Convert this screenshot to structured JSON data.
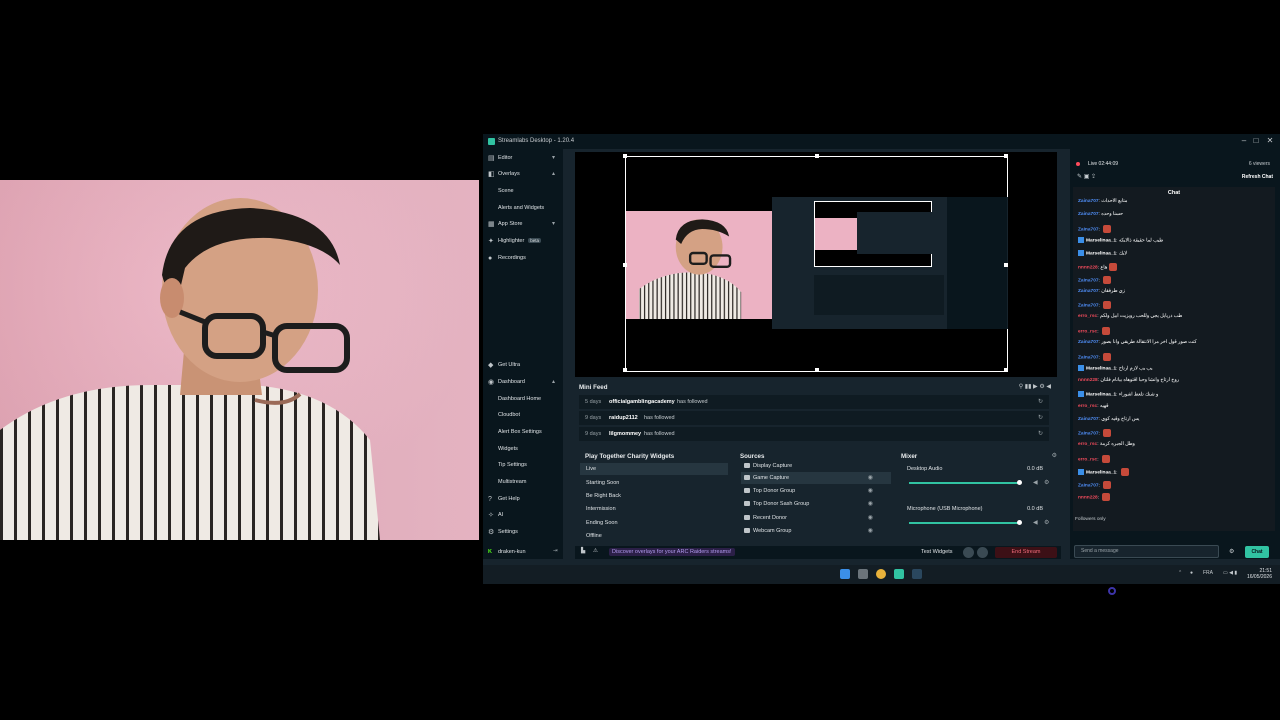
{
  "app": {
    "title": "Streamlabs Desktop - 1.20.4"
  },
  "sidebar": {
    "items": [
      {
        "label": "Editor",
        "icon": "editor-icon",
        "chevron": "▾"
      },
      {
        "label": "Overlays",
        "icon": "overlays-icon",
        "chevron": "▴"
      },
      {
        "label": "Scene",
        "sub": true
      },
      {
        "label": "Alerts and Widgets",
        "sub": true
      },
      {
        "label": "App Store",
        "icon": "app-store-icon",
        "chevron": "▾"
      },
      {
        "label": "Highlighter",
        "icon": "highlighter-icon",
        "badge": "beta"
      },
      {
        "label": "Recordings",
        "icon": "recordings-icon"
      }
    ],
    "bottom_items": [
      {
        "label": "Get Ultra",
        "icon": "ultra-icon"
      },
      {
        "label": "Dashboard",
        "icon": "dashboard-icon",
        "chevron": "▴"
      },
      {
        "label": "Dashboard Home",
        "sub": true
      },
      {
        "label": "Cloudbot",
        "sub": true
      },
      {
        "label": "Alert Box Settings",
        "sub": true
      },
      {
        "label": "Widgets",
        "sub": true
      },
      {
        "label": "Tip Settings",
        "sub": true
      },
      {
        "label": "Multistream",
        "sub": true
      },
      {
        "label": "Get Help",
        "icon": "help-icon"
      },
      {
        "label": "AI",
        "icon": "ai-icon"
      },
      {
        "label": "Settings",
        "icon": "gear-icon"
      }
    ],
    "user": "draken-kun"
  },
  "minifeed": {
    "title": "Mini Feed",
    "rows": [
      {
        "age": "5 days",
        "name": "officialgamblingacademy",
        "action": "has followed"
      },
      {
        "age": "9 days",
        "name": "raidup2112",
        "action": "has followed"
      },
      {
        "age": "9 days",
        "name": "lilgmommey",
        "action": "has followed"
      }
    ]
  },
  "scenes": {
    "title": "Play Together Charity Widgets",
    "items": [
      "Live",
      "Starting Soon",
      "Be Right Back",
      "Intermission",
      "Ending Soon",
      "Offline"
    ]
  },
  "sources": {
    "title": "Sources",
    "items": [
      "Display Capture",
      "Game Capture",
      "Top Donor Group",
      "Top Donor Sash Group",
      "Recent Donor",
      "Webcam Group"
    ]
  },
  "mixer": {
    "title": "Mixer",
    "channels": [
      {
        "name": "Desktop Audio",
        "db": "0.0 dB",
        "level": 0.8
      },
      {
        "name": "Microphone (USB Microphone)",
        "db": "0.0 dB",
        "level": 0.8
      }
    ]
  },
  "footer": {
    "promo": "Discover overlays for your ARC Raiders streams!",
    "test_widgets": "Test Widgets",
    "end_stream": "End Stream"
  },
  "chat": {
    "live": "Live 02:44:09",
    "viewers": "6 viewers",
    "refresh": "Refresh Chat",
    "title": "Chat",
    "messages": [
      {
        "user": "Zaina707",
        "text": "متابع الاحداث",
        "color": "#4f8ef7"
      },
      {
        "user": "Zaina707",
        "text": "حسنا وحده",
        "color": "#4f8ef7"
      },
      {
        "user": "Zaina707",
        "text": "",
        "color": "#4f8ef7",
        "emote": true
      },
      {
        "user": "Marselinaa_1",
        "text": "طيب لما حقيقة ذالايكه",
        "color": "#ffffff",
        "badge": true
      },
      {
        "user": "Marselinaa_1",
        "text": "لايك",
        "color": "#ffffff",
        "badge": true
      },
      {
        "user": "nnnn228",
        "text": "هاع",
        "color": "#f14b5c",
        "emote": true
      },
      {
        "user": "Zaina707",
        "text": "",
        "color": "#4f8ef7",
        "emote": true
      },
      {
        "user": "Zaina707",
        "text": "زي طرفقان",
        "color": "#4f8ef7"
      },
      {
        "user": "Zaina707",
        "text": "",
        "color": "#4f8ef7",
        "emote": true
      },
      {
        "user": "erro_rsc",
        "text": "طب دريايل يجي وللحب رويزيت ابيل ولكم",
        "color": "#f14b5c"
      },
      {
        "user": "erro_rsc",
        "text": "",
        "color": "#f14b5c",
        "emote": true
      },
      {
        "user": "Zaina707",
        "text": "كنت صور قول اخر مرا الانتقالة طريقي وانا بصور",
        "color": "#4f8ef7"
      },
      {
        "user": "Zaina707",
        "text": "",
        "color": "#4f8ef7",
        "emote": true
      },
      {
        "user": "Marselinaa_1",
        "text": "يب يب لازم ارتاح",
        "color": "#ffffff",
        "badge": true
      },
      {
        "user": "nnnn228",
        "text": "روح ارتاح وانشا وحبا اقتوهاه بيانام فلتان",
        "color": "#f14b5c"
      },
      {
        "user": "Marselinaa_1",
        "text": "و شنك تلعط اشوراء",
        "color": "#ffffff",
        "badge": true
      },
      {
        "user": "erro_rsc",
        "text": "قهيه",
        "color": "#f14b5c"
      },
      {
        "user": "Zaina707",
        "text": "يس ارتاح وقيه كوي",
        "color": "#4f8ef7"
      },
      {
        "user": "Zaina707",
        "text": "",
        "color": "#4f8ef7",
        "emote": true
      },
      {
        "user": "erro_rsc",
        "text": "وطل الجبره كرمة",
        "color": "#f14b5c"
      },
      {
        "user": "erro_rsc",
        "text": "",
        "color": "#f14b5c",
        "emote": true
      },
      {
        "user": "Marselinaa_1",
        "text": "",
        "color": "#ffffff",
        "badge": true,
        "emote": true
      },
      {
        "user": "Zaina707",
        "text": "",
        "color": "#4f8ef7",
        "emote": true
      },
      {
        "user": "nnnn228",
        "text": "",
        "color": "#f14b5c",
        "emote": true
      }
    ],
    "followers_only": "Followers only",
    "placeholder": "Send a message",
    "send": "Chat"
  },
  "taskbar": {
    "lang": "FRA",
    "time": "21:51",
    "date": "16/05/2026"
  }
}
